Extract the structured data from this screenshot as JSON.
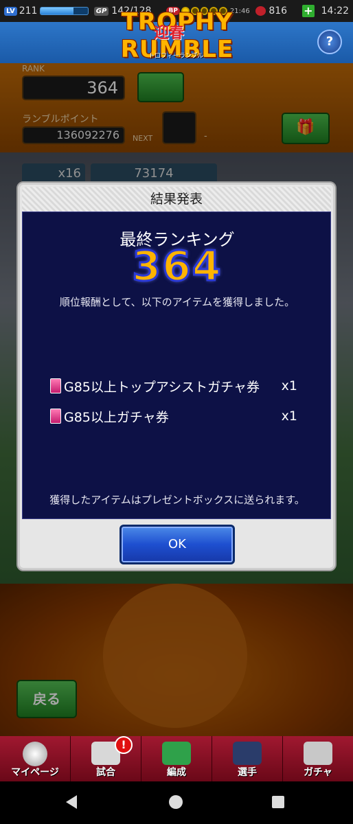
{
  "status_bar": {
    "lv_badge": "LV",
    "level": "211",
    "gp_badge": "GP",
    "gp": "142/128",
    "bp_badge": "BP",
    "bp_timer": "21:46",
    "fist_count": "816",
    "plus": "+",
    "clock": "14:22"
  },
  "header": {
    "logo_text": "TROPHY RUMBLE",
    "logo_kanji": "迎春",
    "logo_sub": "トロフィーランブル",
    "help": "?"
  },
  "rank_panel": {
    "rank_label": "RANK",
    "rank_value": "364",
    "points_label": "ランブルポイント",
    "points_value": "136092276",
    "next_label": "NEXT",
    "next_value": "-"
  },
  "counters": {
    "left": "x16",
    "right": "73174"
  },
  "modal": {
    "title": "結果発表",
    "heading": "最終ランキング",
    "rank": "364",
    "description": "順位報酬として、以下のアイテムを獲得しました。",
    "rewards": [
      {
        "name": "G85以上トップアシストガチャ券",
        "qty": "x1"
      },
      {
        "name": "G85以上ガチャ券",
        "qty": "x1"
      }
    ],
    "footer": "獲得したアイテムはプレゼントボックスに送られます。",
    "ok_label": "OK"
  },
  "back_button": "戻る",
  "tabs": [
    {
      "label": "マイページ"
    },
    {
      "label": "試合",
      "alert": "!"
    },
    {
      "label": "編成"
    },
    {
      "label": "選手"
    },
    {
      "label": "ガチャ"
    }
  ]
}
